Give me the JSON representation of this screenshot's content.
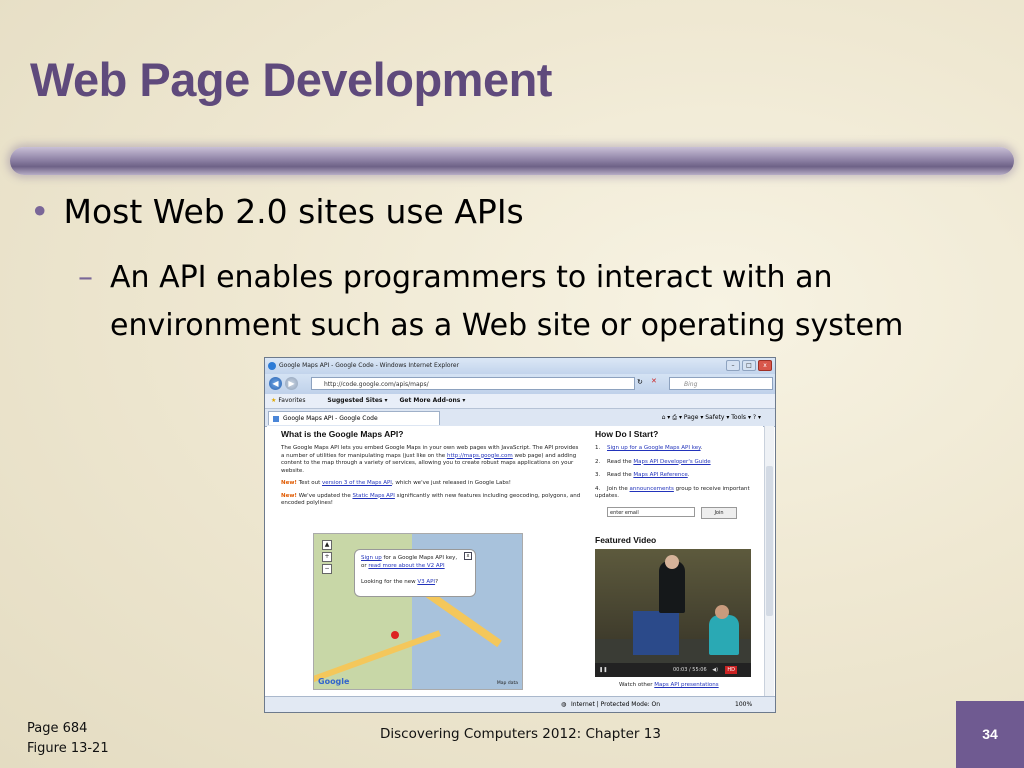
{
  "slide": {
    "title": "Web Page Development",
    "bullet1": "Most Web 2.0 sites use APIs",
    "bullet2_marker": "–",
    "bullet2": "An API enables programmers to interact with an environment such as a Web site or operating system",
    "footer_page": "Page 684",
    "footer_figure": "Figure 13-21",
    "footer_center": "Discovering Computers 2012: Chapter 13",
    "slide_number": "34"
  },
  "browser": {
    "window_title": "Google Maps API - Google Code - Windows Internet Explorer",
    "address": "http://code.google.com/apis/maps/",
    "search_placeholder": "Bing",
    "favorites_label": "Favorites",
    "suggested_sites": "Suggested Sites ▾",
    "get_addons": "Get More Add-ons ▾",
    "tab_label": "Google Maps API - Google Code",
    "command_bar": "Page ▾   Safety ▾   Tools ▾",
    "status_zone": "Internet | Protected Mode: On",
    "zoom": "100%"
  },
  "content": {
    "left_heading": "What is the Google Maps API?",
    "intro_pre": "The Google Maps API lets you embed Google Maps in your own web pages with JavaScript. The API provides a number of utilities for manipulating maps (just like on the",
    "intro_link": "http://maps.google.com",
    "intro_post": "web page) and adding content to the map through a variety of services, allowing you to create robust maps applications on your website.",
    "new_label": "New!",
    "new1_pre": "Test out",
    "new1_link": "version 3 of the Maps API",
    "new1_post": ", which we've just released in Google Labs!",
    "new2_pre": "We've updated the",
    "new2_link": "Static Maps API",
    "new2_post": "significantly with new features including geocoding, polygons, and encoded polylines!",
    "popup_signup": "Sign up",
    "popup_line1": "for a Google Maps API key,",
    "popup_or": "or",
    "popup_readmore": "read more about the V2 API",
    "popup_line3": "Looking for the new",
    "popup_v3": "V3 API",
    "map_brand": "Google",
    "map_data": "Map data",
    "right_heading": "How Do I Start?",
    "steps": [
      {
        "num": "1.",
        "pre": "",
        "link": "Sign up for a Google Maps API key",
        "post": "."
      },
      {
        "num": "2.",
        "pre": "Read the",
        "link": "Maps API Developer's Guide",
        "post": ""
      },
      {
        "num": "3.",
        "pre": "Read the",
        "link": "Maps API Reference",
        "post": "."
      },
      {
        "num": "4.",
        "pre": "Join the",
        "link": "announcements",
        "post": "group to receive important updates."
      }
    ],
    "email_placeholder": "enter email",
    "join_label": "Join",
    "featured_heading": "Featured Video",
    "video_time": "00:03 / 55:06",
    "video_hd": "HD",
    "watch_pre": "Watch other",
    "watch_link": "Maps API presentations"
  }
}
